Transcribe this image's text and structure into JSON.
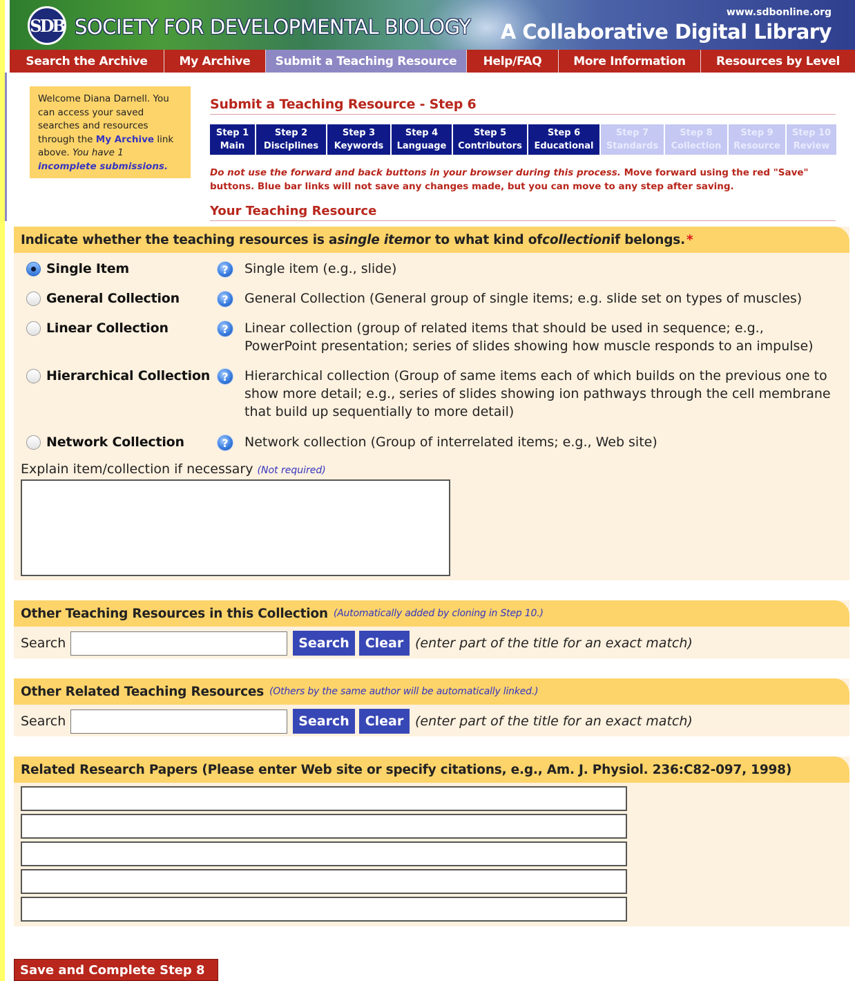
{
  "header": {
    "logo_text": "SDB",
    "society_name": "SOCIETY FOR DEVELOPMENTAL BIOLOGY",
    "site_url": "www.sdbonline.org",
    "tagline": "A Collaborative Digital Library"
  },
  "nav": {
    "items": [
      {
        "label": "Search the Archive"
      },
      {
        "label": "My Archive"
      },
      {
        "label": "Submit a Teaching Resource"
      },
      {
        "label": "Help/FAQ"
      },
      {
        "label": "More Information"
      },
      {
        "label": "Resources by Level"
      }
    ],
    "active": "Submit a Teaching Resource"
  },
  "welcome": {
    "line1": "Welcome Diana Darnell. You can access your saved searches and resources through the ",
    "link": "My Archive",
    "line2": " link above. ",
    "italic": "You have 1 ",
    "incomplete_link": "incomplete submissions."
  },
  "page_title": "Submit a Teaching Resource - Step 6",
  "steps": [
    {
      "num": "Step 1",
      "name": "Main",
      "enabled": true
    },
    {
      "num": "Step 2",
      "name": "Disciplines",
      "enabled": true
    },
    {
      "num": "Step 3",
      "name": "Keywords",
      "enabled": true
    },
    {
      "num": "Step 4",
      "name": "Language",
      "enabled": true
    },
    {
      "num": "Step 5",
      "name": "Contributors",
      "enabled": true
    },
    {
      "num": "Step 6",
      "name": "Educational",
      "enabled": true
    },
    {
      "num": "Step 7",
      "name": "Standards",
      "enabled": false
    },
    {
      "num": "Step 8",
      "name": "Collection",
      "enabled": false
    },
    {
      "num": "Step 9",
      "name": "Resource",
      "enabled": false
    },
    {
      "num": "Step 10",
      "name": "Review",
      "enabled": false
    }
  ],
  "warning": {
    "italic": "Do not use the forward and back buttons in your browser during this process.",
    "rest": " Move forward using the red \"Save\" buttons. Blue bar links will not save any changes made, but you can move to any step after saving."
  },
  "your_resource_title": "Your Teaching Resource",
  "collection_section": {
    "heading_part1": "Indicate whether the teaching resources is a ",
    "heading_em1": "single item",
    "heading_part2": " or to what kind of ",
    "heading_em2": "collection",
    "heading_part3": " if belongs.",
    "required_mark": "*",
    "options": [
      {
        "label": "Single Item",
        "desc": "Single item (e.g., slide)",
        "checked": true
      },
      {
        "label": "General Collection",
        "desc": "General Collection (General group of single items; e.g. slide set on types of muscles)",
        "checked": false
      },
      {
        "label": "Linear Collection",
        "desc": "Linear collection (group of related items that should be used in sequence; e.g., PowerPoint presentation; series of slides showing how muscle responds to an impulse)",
        "checked": false
      },
      {
        "label": "Hierarchical Collection",
        "desc": "Hierarchical collection (Group of same items each of which builds on the previous one to show more detail; e.g., series of slides showing ion pathways through the cell membrane that build up sequentially to more detail)",
        "checked": false
      },
      {
        "label": "Network Collection",
        "desc": "Network collection (Group of interrelated items; e.g., Web site)",
        "checked": false
      }
    ],
    "help_glyph": "?",
    "explain_label": "Explain item/collection if necessary ",
    "explain_note": "(Not required)",
    "explain_value": ""
  },
  "in_collection": {
    "heading": "Other Teaching Resources in this Collection",
    "note": "(Automatically added by cloning in Step 10.)",
    "search_label": "Search",
    "search_value": "",
    "search_button": "Search",
    "clear_button": "Clear",
    "hint": "(enter part of the title for an exact match)"
  },
  "related": {
    "heading": "Other Related Teaching Resources",
    "note": "(Others by the same author will be automatically linked.)",
    "search_label": "Search",
    "search_value": "",
    "search_button": "Search",
    "clear_button": "Clear",
    "hint": "(enter part of the title for an exact match)"
  },
  "papers": {
    "heading": "Related Research Papers (Please enter Web site or specify citations, e.g., Am. J. Physiol. 236:C82-097, 1998)",
    "inputs": [
      "",
      "",
      "",
      "",
      ""
    ]
  },
  "save_button": "Save and Complete Step 8",
  "icons": {
    "help": "question-circle-icon",
    "logo": "sdb-logo-icon"
  },
  "colors": {
    "nav_red": "#b8261c",
    "nav_active": "#8d88c4",
    "step_blue": "#0f1a88",
    "step_disabled": "#c4c8f2",
    "section_head": "#fdd46a",
    "section_body": "#fdf1df",
    "button_blue": "#3847b6"
  }
}
